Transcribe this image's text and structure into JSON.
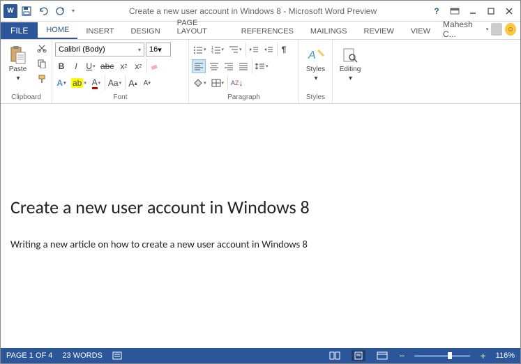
{
  "titlebar": {
    "title": "Create a new user account in Windows 8 - Microsoft Word Preview"
  },
  "tabs": {
    "file": "FILE",
    "items": [
      "HOME",
      "INSERT",
      "DESIGN",
      "PAGE LAYOUT",
      "REFERENCES",
      "MAILINGS",
      "REVIEW",
      "VIEW"
    ],
    "active": 0,
    "user": "Mahesh C..."
  },
  "ribbon": {
    "clipboard": {
      "label": "Clipboard",
      "paste": "Paste"
    },
    "font": {
      "label": "Font",
      "name": "Calibri (Body)",
      "size": "16"
    },
    "paragraph": {
      "label": "Paragraph"
    },
    "styles": {
      "label": "Styles",
      "btn": "Styles"
    },
    "editing": {
      "label": "",
      "btn": "Editing"
    }
  },
  "document": {
    "heading": "Create a new user account in Windows 8",
    "body": "Writing a new article on how to create a new user account in Windows 8"
  },
  "status": {
    "page": "PAGE 1 OF 4",
    "words": "23 WORDS",
    "zoom": "116%"
  }
}
